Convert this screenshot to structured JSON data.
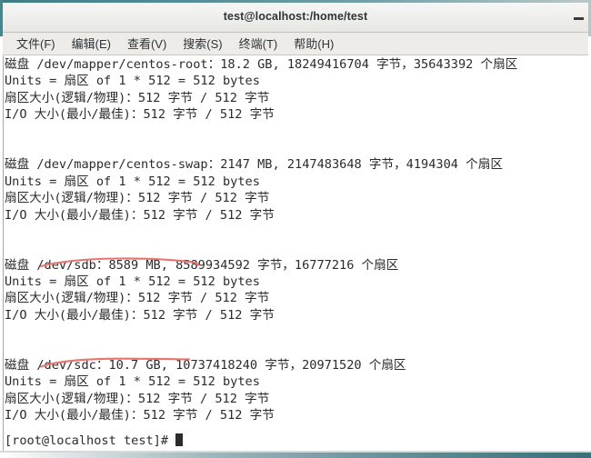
{
  "window": {
    "title": "test@localhost:/home/test",
    "minimize_label": "–"
  },
  "menubar": {
    "items": [
      {
        "label": "文件(F)",
        "name": "menu-file"
      },
      {
        "label": "编辑(E)",
        "name": "menu-edit"
      },
      {
        "label": "查看(V)",
        "name": "menu-view"
      },
      {
        "label": "搜索(S)",
        "name": "menu-search"
      },
      {
        "label": "终端(T)",
        "name": "menu-terminal"
      },
      {
        "label": "帮助(H)",
        "name": "menu-help"
      }
    ]
  },
  "terminal": {
    "lines": [
      "磁盘 /dev/mapper/centos-root：18.2 GB, 18249416704 字节，35643392 个扇区",
      "Units = 扇区 of 1 * 512 = 512 bytes",
      "扇区大小(逻辑/物理)：512 字节 / 512 字节",
      "I/O 大小(最小/最佳)：512 字节 / 512 字节",
      "",
      "",
      "磁盘 /dev/mapper/centos-swap：2147 MB, 2147483648 字节，4194304 个扇区",
      "Units = 扇区 of 1 * 512 = 512 bytes",
      "扇区大小(逻辑/物理)：512 字节 / 512 字节",
      "I/O 大小(最小/最佳)：512 字节 / 512 字节",
      "",
      "",
      "磁盘 /dev/sdb：8589 MB, 8589934592 字节，16777216 个扇区",
      "Units = 扇区 of 1 * 512 = 512 bytes",
      "扇区大小(逻辑/物理)：512 字节 / 512 字节",
      "I/O 大小(最小/最佳)：512 字节 / 512 字节",
      "",
      "",
      "磁盘 /dev/sdc：10.7 GB, 10737418240 字节，20971520 个扇区",
      "Units = 扇区 of 1 * 512 = 512 bytes",
      "扇区大小(逻辑/物理)：512 字节 / 512 字节",
      "I/O 大小(最小/最佳)：512 字节 / 512 字节"
    ],
    "prompt": "[root@localhost test]# "
  },
  "annotations": {
    "color": "#e8746f",
    "marks": [
      {
        "name": "underline-sdb",
        "target": "/dev/sdb：8589 MB,"
      },
      {
        "name": "underline-sdc",
        "target": "/dev/sdc：10.7 GB,"
      }
    ]
  },
  "colors": {
    "frame": "#4a848b",
    "titlebar": "#eeeeec",
    "menubar": "#edece9",
    "terminal_bg": "#ffffff",
    "terminal_fg": "#2b2b2b",
    "annotation_red": "#e8746f"
  }
}
